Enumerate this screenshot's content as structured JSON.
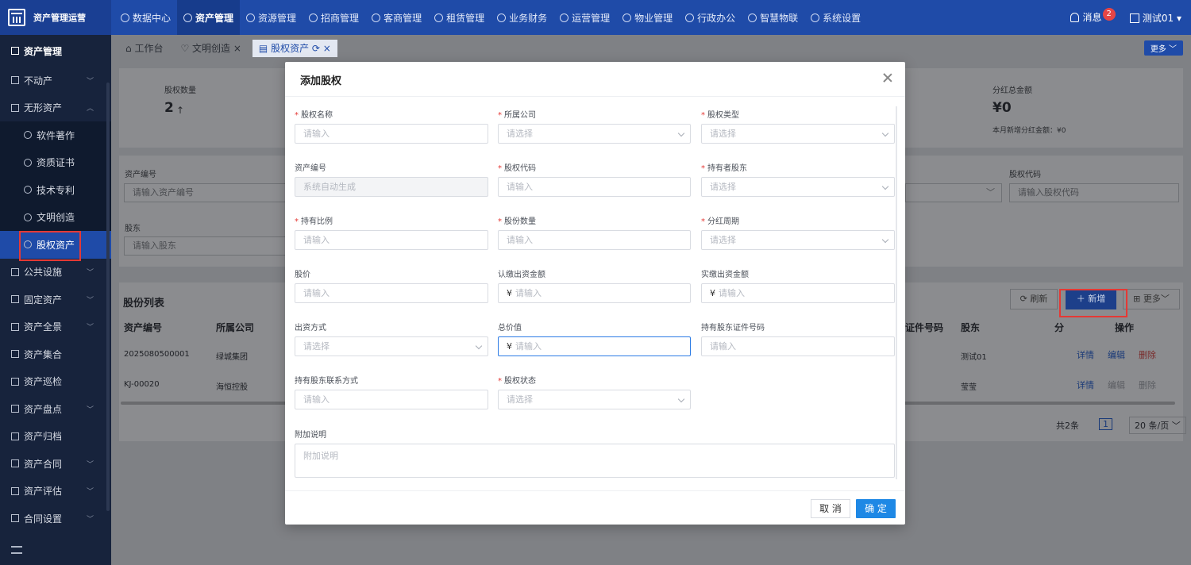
{
  "app": {
    "name": "资产管理运营"
  },
  "nav": [
    {
      "label": "数据中心",
      "active": false
    },
    {
      "label": "资产管理",
      "active": true
    },
    {
      "label": "资源管理",
      "active": false
    },
    {
      "label": "招商管理",
      "active": false
    },
    {
      "label": "客商管理",
      "active": false
    },
    {
      "label": "租赁管理",
      "active": false
    },
    {
      "label": "业务财务",
      "active": false
    },
    {
      "label": "运营管理",
      "active": false
    },
    {
      "label": "物业管理",
      "active": false
    },
    {
      "label": "行政办公",
      "active": false
    },
    {
      "label": "智慧物联",
      "active": false
    },
    {
      "label": "系统设置",
      "active": false
    }
  ],
  "topRight": {
    "messages": "消息",
    "messageCount": "2",
    "user": "测试01"
  },
  "sidebar": {
    "header": "资产管理",
    "items": [
      "不动产",
      "无形资产"
    ],
    "subItems": [
      "软件著作",
      "资质证书",
      "技术专利",
      "文明创造"
    ],
    "activeItem": "股权资产",
    "lowerItems": [
      "公共设施",
      "固定资产",
      "资产全景",
      "资产集合",
      "资产巡检",
      "资产盘点",
      "资产归档",
      "资产合同",
      "资产评估",
      "合同设置"
    ]
  },
  "tabs": [
    "工作台",
    "文明创造",
    "股权资产"
  ],
  "moreLabel": "更多",
  "stats": {
    "leftLabel": "股权数量",
    "leftValue": "2",
    "rightLabel": "分红总金额",
    "rightValue": "¥0",
    "rightSub": "本月新增分红金额：¥0"
  },
  "filters": {
    "assetNoLabel": "资产编号",
    "assetNoPlaceholder": "请输入资产编号",
    "holderLabel": "股东",
    "holderPlaceholder": "请输入股东",
    "codeLabel": "股权代码",
    "codePlaceholder": "请输入股权代码"
  },
  "list": {
    "title": "股份列表",
    "refresh": "刷新",
    "add": "新增",
    "more": "更多",
    "headers": [
      "资产编号",
      "所属公司",
      "证件号码",
      "股东",
      "分",
      "操作"
    ],
    "rows": [
      {
        "no": "2025080500001",
        "company": "绿城集团",
        "holder": "测试01"
      },
      {
        "no": "KJ-00020",
        "company": "海恒控股",
        "holder": "莹莹"
      }
    ],
    "actions": [
      "详情",
      "编辑",
      "删除"
    ],
    "total": "共2条",
    "page": "1",
    "pageSize": "20 条/页"
  },
  "modal": {
    "title": "添加股权",
    "fields": {
      "name": {
        "label": "股权名称",
        "placeholder": "请输入"
      },
      "company": {
        "label": "所属公司",
        "placeholder": "请选择"
      },
      "type": {
        "label": "股权类型",
        "placeholder": "请选择"
      },
      "assetNo": {
        "label": "资产编号",
        "placeholder": "系统自动生成"
      },
      "code": {
        "label": "股权代码",
        "placeholder": "请输入"
      },
      "holder": {
        "label": "持有者股东",
        "placeholder": "请选择"
      },
      "ratio": {
        "label": "持有比例",
        "placeholder": "请输入"
      },
      "shares": {
        "label": "股份数量",
        "placeholder": "请输入"
      },
      "period": {
        "label": "分红周期",
        "placeholder": "请选择"
      },
      "price": {
        "label": "股价",
        "placeholder": "请输入"
      },
      "subscribed": {
        "label": "认缴出资金额",
        "placeholder": "请输入",
        "prefix": "¥"
      },
      "paid": {
        "label": "实缴出资金额",
        "placeholder": "请输入",
        "prefix": "¥"
      },
      "method": {
        "label": "出资方式",
        "placeholder": "请选择"
      },
      "total": {
        "label": "总价值",
        "placeholder": "请输入",
        "prefix": "¥"
      },
      "idNo": {
        "label": "持有股东证件号码",
        "placeholder": "请输入"
      },
      "contact": {
        "label": "持有股东联系方式",
        "placeholder": "请输入"
      },
      "status": {
        "label": "股权状态",
        "placeholder": "请选择"
      },
      "note": {
        "label": "附加说明",
        "placeholder": "附加说明"
      }
    },
    "cancel": "取 消",
    "ok": "确 定"
  },
  "colors": {
    "primary": "#1f4ba8",
    "accent": "#1e88e5",
    "required": "#e53935"
  }
}
